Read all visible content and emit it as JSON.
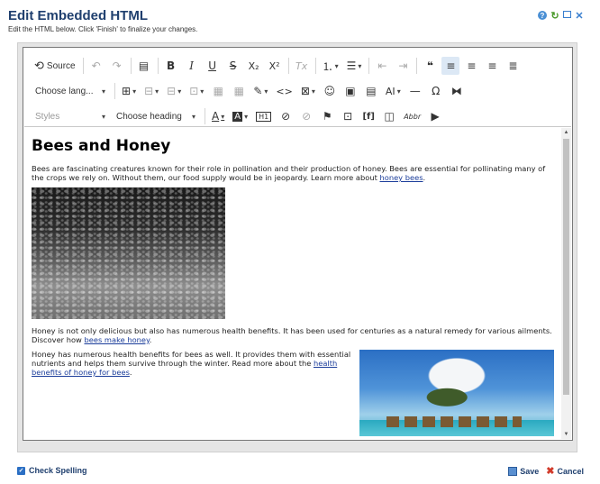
{
  "dialog": {
    "title": "Edit Embedded HTML",
    "subtitle": "Edit the HTML below. Click 'Finish' to finalize your changes.",
    "icons": [
      "help-icon",
      "refresh-icon",
      "maximize-icon",
      "close-icon"
    ]
  },
  "toolbar": {
    "source_label": "Source",
    "language_combo": "Choose lang...",
    "styles_combo": "Styles",
    "heading_combo": "Choose heading",
    "h1_label": "H1",
    "ai_label": "AI",
    "f_label": "[f]",
    "abbr_label": "Abbr",
    "bold": "B",
    "italic": "I",
    "underline": "U",
    "strike": "S",
    "subscript": "X₂",
    "superscript": "X²",
    "clear_format": "Tx",
    "omega": "Ω",
    "code": "<>",
    "quote": "❝"
  },
  "content": {
    "heading": "Bees and Honey",
    "p1_text": "Bees are fascinating creatures known for their role in pollination and their production of honey. Bees are essential for pollinating many of the crops we rely on. Without them, our food supply would be in jeopardy. Learn more about ",
    "p1_link": "honey bees",
    "p1_end": ".",
    "p2_text": "Honey is not only delicious but also has numerous health benefits. It has been used for centuries as a natural remedy for various ailments. Discover how ",
    "p2_link": "bees make honey",
    "p2_end": ".",
    "p3_text": "Honey has numerous health benefits for bees as well. It provides them with essential nutrients and helps them survive through the winter. Read more about the ",
    "p3_link": "health benefits of honey for bees",
    "p3_end": "."
  },
  "footer": {
    "check_spelling_label": "Check Spelling",
    "check_spelling_checked": true,
    "save_label": "Save",
    "cancel_label": "Cancel"
  },
  "colors": {
    "title": "#1f3f6e",
    "link": "#1a3c9a",
    "active_button": "#dce8f5",
    "cancel_icon": "#d23a2a"
  }
}
